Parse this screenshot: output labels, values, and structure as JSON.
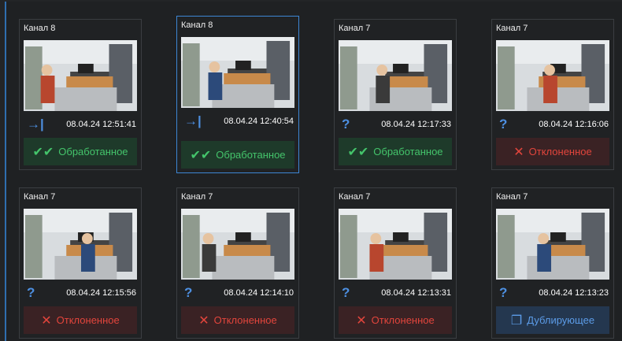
{
  "cards": [
    {
      "channel": "Канал 8",
      "time": "08.04.24 12:51:41",
      "status_icon": "arrow-into-icon",
      "status_icon_glyph": "→|",
      "status_label": "Обработанное",
      "status_type": "processed",
      "selected": false
    },
    {
      "channel": "Канал 8",
      "time": "08.04.24 12:40:54",
      "status_icon": "arrow-into-icon",
      "status_icon_glyph": "→|",
      "status_label": "Обработанное",
      "status_type": "processed",
      "selected": true
    },
    {
      "channel": "Канал 7",
      "time": "08.04.24 12:17:33",
      "status_icon": "question-icon",
      "status_icon_glyph": "?",
      "status_label": "Обработанное",
      "status_type": "processed",
      "selected": false
    },
    {
      "channel": "Канал 7",
      "time": "08.04.24 12:16:06",
      "status_icon": "question-icon",
      "status_icon_glyph": "?",
      "status_label": "Отклоненное",
      "status_type": "rejected",
      "selected": false
    },
    {
      "channel": "Канал 7",
      "time": "08.04.24 12:15:56",
      "status_icon": "question-icon",
      "status_icon_glyph": "?",
      "status_label": "Отклоненное",
      "status_type": "rejected",
      "selected": false
    },
    {
      "channel": "Канал 7",
      "time": "08.04.24 12:14:10",
      "status_icon": "question-icon",
      "status_icon_glyph": "?",
      "status_label": "Отклоненное",
      "status_type": "rejected",
      "selected": false
    },
    {
      "channel": "Канал 7",
      "time": "08.04.24 12:13:31",
      "status_icon": "question-icon",
      "status_icon_glyph": "?",
      "status_label": "Отклоненное",
      "status_type": "rejected",
      "selected": false
    },
    {
      "channel": "Канал 7",
      "time": "08.04.24 12:13:23",
      "status_icon": "question-icon",
      "status_icon_glyph": "?",
      "status_label": "Дублирующее",
      "status_type": "duplicate",
      "selected": false
    }
  ],
  "status_glyphs": {
    "processed": "✔✔",
    "rejected": "✕",
    "duplicate": "❐"
  },
  "colors": {
    "processed": "#44c46b",
    "rejected": "#e2453c",
    "duplicate": "#5c9ce8",
    "accent": "#3d86d4"
  }
}
